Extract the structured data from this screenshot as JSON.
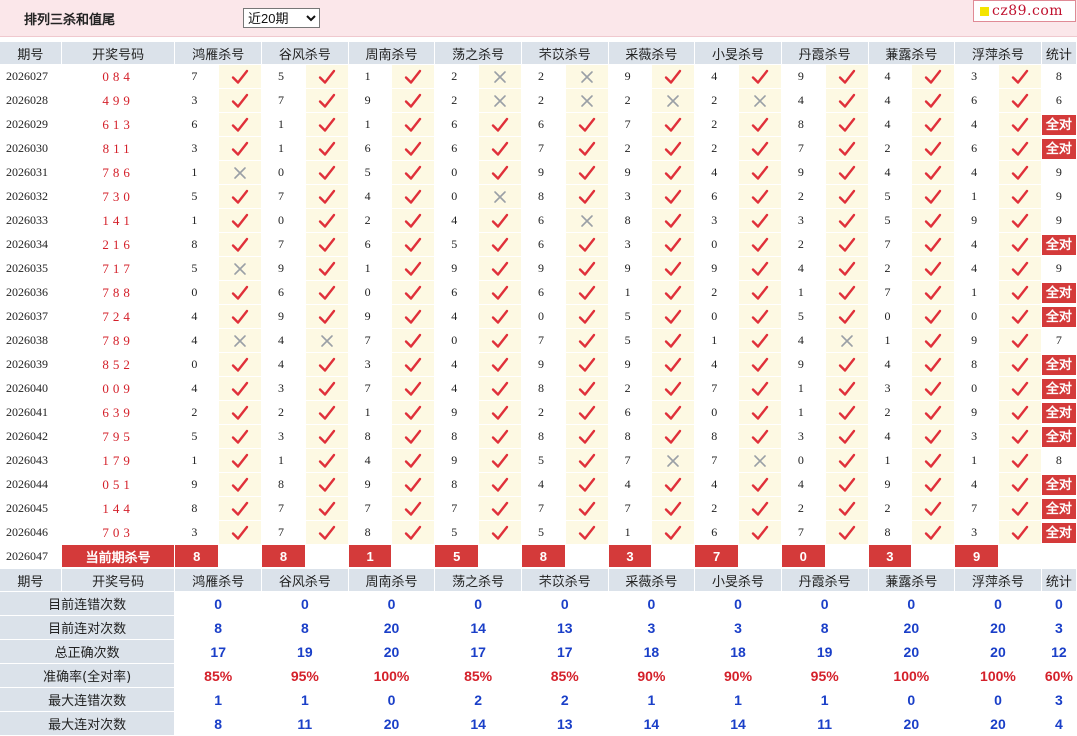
{
  "header": {
    "title": "排列三杀和值尾",
    "period_select": "近20期",
    "logo_text": "cz89.com"
  },
  "columns": {
    "period": "期号",
    "draw": "开奖号码",
    "stat": "统计",
    "experts": [
      "鸿雁杀号",
      "谷风杀号",
      "周南杀号",
      "荡之杀号",
      "芣苡杀号",
      "采薇杀号",
      "小旻杀号",
      "丹霞杀号",
      "蒹露杀号",
      "浮萍杀号"
    ]
  },
  "rows": [
    {
      "period": "2026027",
      "draw": "084",
      "kills": [
        "7",
        "5",
        "1",
        "2",
        "2",
        "9",
        "4",
        "9",
        "4",
        "3"
      ],
      "hits": [
        1,
        1,
        1,
        0,
        0,
        1,
        1,
        1,
        1,
        1
      ],
      "stat": "8"
    },
    {
      "period": "2026028",
      "draw": "499",
      "kills": [
        "3",
        "7",
        "9",
        "2",
        "2",
        "2",
        "2",
        "4",
        "4",
        "6"
      ],
      "hits": [
        1,
        1,
        1,
        0,
        0,
        0,
        0,
        1,
        1,
        1
      ],
      "stat": "6"
    },
    {
      "period": "2026029",
      "draw": "613",
      "kills": [
        "6",
        "1",
        "1",
        "6",
        "6",
        "7",
        "2",
        "8",
        "4",
        "4"
      ],
      "hits": [
        1,
        1,
        1,
        1,
        1,
        1,
        1,
        1,
        1,
        1
      ],
      "stat": "全对"
    },
    {
      "period": "2026030",
      "draw": "811",
      "kills": [
        "3",
        "1",
        "6",
        "6",
        "7",
        "2",
        "2",
        "7",
        "2",
        "6"
      ],
      "hits": [
        1,
        1,
        1,
        1,
        1,
        1,
        1,
        1,
        1,
        1
      ],
      "stat": "全对"
    },
    {
      "period": "2026031",
      "draw": "786",
      "kills": [
        "1",
        "0",
        "5",
        "0",
        "9",
        "9",
        "4",
        "9",
        "4",
        "4"
      ],
      "hits": [
        0,
        1,
        1,
        1,
        1,
        1,
        1,
        1,
        1,
        1
      ],
      "stat": "9"
    },
    {
      "period": "2026032",
      "draw": "730",
      "kills": [
        "5",
        "7",
        "4",
        "0",
        "8",
        "3",
        "6",
        "2",
        "5",
        "1"
      ],
      "hits": [
        1,
        1,
        1,
        0,
        1,
        1,
        1,
        1,
        1,
        1
      ],
      "stat": "9"
    },
    {
      "period": "2026033",
      "draw": "141",
      "kills": [
        "1",
        "0",
        "2",
        "4",
        "6",
        "8",
        "3",
        "3",
        "5",
        "9"
      ],
      "hits": [
        1,
        1,
        1,
        1,
        0,
        1,
        1,
        1,
        1,
        1
      ],
      "stat": "9"
    },
    {
      "period": "2026034",
      "draw": "216",
      "kills": [
        "8",
        "7",
        "6",
        "5",
        "6",
        "3",
        "0",
        "2",
        "7",
        "4"
      ],
      "hits": [
        1,
        1,
        1,
        1,
        1,
        1,
        1,
        1,
        1,
        1
      ],
      "stat": "全对"
    },
    {
      "period": "2026035",
      "draw": "717",
      "kills": [
        "5",
        "9",
        "1",
        "9",
        "9",
        "9",
        "9",
        "4",
        "2",
        "4"
      ],
      "hits": [
        0,
        1,
        1,
        1,
        1,
        1,
        1,
        1,
        1,
        1
      ],
      "stat": "9"
    },
    {
      "period": "2026036",
      "draw": "788",
      "kills": [
        "0",
        "6",
        "0",
        "6",
        "6",
        "1",
        "2",
        "1",
        "7",
        "1"
      ],
      "hits": [
        1,
        1,
        1,
        1,
        1,
        1,
        1,
        1,
        1,
        1
      ],
      "stat": "全对"
    },
    {
      "period": "2026037",
      "draw": "724",
      "kills": [
        "4",
        "9",
        "9",
        "4",
        "0",
        "5",
        "0",
        "5",
        "0",
        "0"
      ],
      "hits": [
        1,
        1,
        1,
        1,
        1,
        1,
        1,
        1,
        1,
        1
      ],
      "stat": "全对"
    },
    {
      "period": "2026038",
      "draw": "789",
      "kills": [
        "4",
        "4",
        "7",
        "0",
        "7",
        "5",
        "1",
        "4",
        "1",
        "9"
      ],
      "hits": [
        0,
        0,
        1,
        1,
        1,
        1,
        1,
        0,
        1,
        1
      ],
      "stat": "7"
    },
    {
      "period": "2026039",
      "draw": "852",
      "kills": [
        "0",
        "4",
        "3",
        "4",
        "9",
        "9",
        "4",
        "9",
        "4",
        "8"
      ],
      "hits": [
        1,
        1,
        1,
        1,
        1,
        1,
        1,
        1,
        1,
        1
      ],
      "stat": "全对"
    },
    {
      "period": "2026040",
      "draw": "009",
      "kills": [
        "4",
        "3",
        "7",
        "4",
        "8",
        "2",
        "7",
        "1",
        "3",
        "0"
      ],
      "hits": [
        1,
        1,
        1,
        1,
        1,
        1,
        1,
        1,
        1,
        1
      ],
      "stat": "全对"
    },
    {
      "period": "2026041",
      "draw": "639",
      "kills": [
        "2",
        "2",
        "1",
        "9",
        "2",
        "6",
        "0",
        "1",
        "2",
        "9"
      ],
      "hits": [
        1,
        1,
        1,
        1,
        1,
        1,
        1,
        1,
        1,
        1
      ],
      "stat": "全对"
    },
    {
      "period": "2026042",
      "draw": "795",
      "kills": [
        "5",
        "3",
        "8",
        "8",
        "8",
        "8",
        "8",
        "3",
        "4",
        "3"
      ],
      "hits": [
        1,
        1,
        1,
        1,
        1,
        1,
        1,
        1,
        1,
        1
      ],
      "stat": "全对"
    },
    {
      "period": "2026043",
      "draw": "179",
      "kills": [
        "1",
        "1",
        "4",
        "9",
        "5",
        "7",
        "7",
        "0",
        "1",
        "1"
      ],
      "hits": [
        1,
        1,
        1,
        1,
        1,
        0,
        0,
        1,
        1,
        1
      ],
      "stat": "8"
    },
    {
      "period": "2026044",
      "draw": "051",
      "kills": [
        "9",
        "8",
        "9",
        "8",
        "4",
        "4",
        "4",
        "4",
        "9",
        "4"
      ],
      "hits": [
        1,
        1,
        1,
        1,
        1,
        1,
        1,
        1,
        1,
        1
      ],
      "stat": "全对"
    },
    {
      "period": "2026045",
      "draw": "144",
      "kills": [
        "8",
        "7",
        "7",
        "7",
        "7",
        "7",
        "2",
        "2",
        "2",
        "7"
      ],
      "hits": [
        1,
        1,
        1,
        1,
        1,
        1,
        1,
        1,
        1,
        1
      ],
      "stat": "全对"
    },
    {
      "period": "2026046",
      "draw": "703",
      "kills": [
        "3",
        "7",
        "8",
        "5",
        "5",
        "1",
        "6",
        "7",
        "8",
        "3"
      ],
      "hits": [
        1,
        1,
        1,
        1,
        1,
        1,
        1,
        1,
        1,
        1
      ],
      "stat": "全对"
    }
  ],
  "current": {
    "period": "2026047",
    "label": "当前期杀号",
    "kills": [
      "8",
      "8",
      "1",
      "5",
      "8",
      "3",
      "7",
      "0",
      "3",
      "9"
    ]
  },
  "stats": [
    {
      "label": "目前连错次数",
      "values": [
        "0",
        "0",
        "0",
        "0",
        "0",
        "0",
        "0",
        "0",
        "0",
        "0"
      ],
      "total": "0"
    },
    {
      "label": "目前连对次数",
      "values": [
        "8",
        "8",
        "20",
        "14",
        "13",
        "3",
        "3",
        "8",
        "20",
        "20"
      ],
      "total": "3"
    },
    {
      "label": "总正确次数",
      "values": [
        "17",
        "19",
        "20",
        "17",
        "17",
        "18",
        "18",
        "19",
        "20",
        "20"
      ],
      "total": "12"
    },
    {
      "label": "准确率(全对率)",
      "values": [
        "85%",
        "95%",
        "100%",
        "85%",
        "85%",
        "90%",
        "90%",
        "95%",
        "100%",
        "100%"
      ],
      "total": "60%"
    },
    {
      "label": "最大连错次数",
      "values": [
        "1",
        "1",
        "0",
        "2",
        "2",
        "1",
        "1",
        "1",
        "0",
        "0"
      ],
      "total": "3"
    },
    {
      "label": "最大连对次数",
      "values": [
        "8",
        "11",
        "20",
        "14",
        "13",
        "14",
        "14",
        "11",
        "20",
        "20"
      ],
      "total": "4"
    }
  ],
  "colors": {
    "header_bg": "#dbe2ea",
    "mark_bg": "#fdf9e3",
    "accent_red": "#d43a3a",
    "check": "#e0303a",
    "cross": "#9aa0a6",
    "stat_blue": "#1a3fc8"
  },
  "icons": {
    "hit": "check-icon",
    "miss": "cross-icon"
  }
}
